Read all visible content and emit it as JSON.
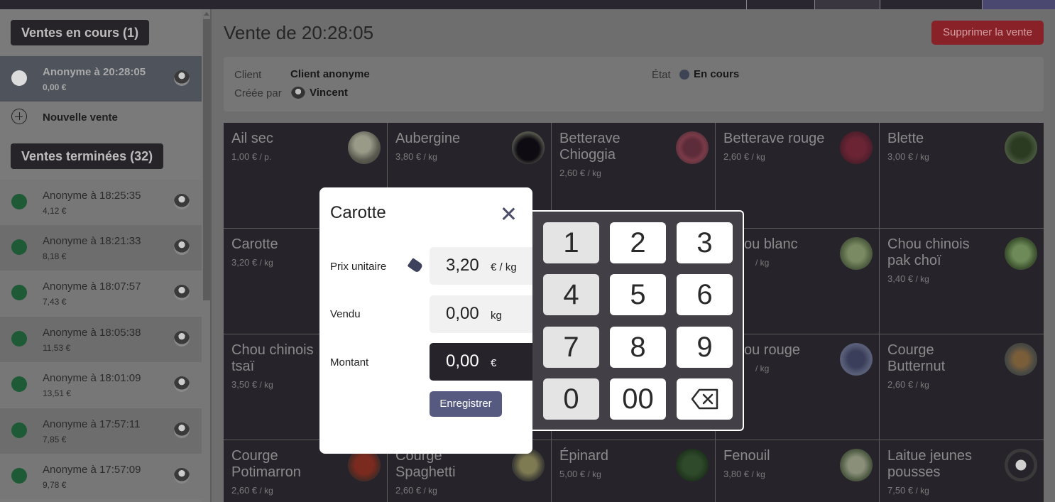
{
  "sidebar": {
    "current_header": "Ventes en cours (1)",
    "current_sale": {
      "title": "Anonyme à 20:28:05",
      "amount": "0,00 €"
    },
    "new_sale_label": "Nouvelle vente",
    "done_header": "Ventes terminées (32)",
    "done_sales": [
      {
        "title": "Anonyme à 18:25:35",
        "amount": "4,12 €"
      },
      {
        "title": "Anonyme à 18:21:33",
        "amount": "8,18 €"
      },
      {
        "title": "Anonyme à 18:07:57",
        "amount": "7,43 €"
      },
      {
        "title": "Anonyme à 18:05:38",
        "amount": "11,53 €"
      },
      {
        "title": "Anonyme à 18:01:09",
        "amount": "13,51 €"
      },
      {
        "title": "Anonyme à 17:57:11",
        "amount": "7,85 €"
      },
      {
        "title": "Anonyme à 17:57:09",
        "amount": "9,78 €"
      }
    ]
  },
  "header": {
    "title": "Vente de 20:28:05",
    "delete_label": "Supprimer la vente"
  },
  "info": {
    "client_label": "Client",
    "client_value": "Client anonyme",
    "creator_label": "Créée par",
    "creator_value": "Vincent",
    "state_label": "État",
    "state_value": "En cours"
  },
  "products": [
    {
      "name": "Ail sec",
      "price": "1,00 €",
      "unit": " / p."
    },
    {
      "name": "Aubergine",
      "price": "3,80 €",
      "unit": " / kg"
    },
    {
      "name": "Betterave Chioggia",
      "price": "2,60 €",
      "unit": " / kg"
    },
    {
      "name": "Betterave rouge",
      "price": "2,60 €",
      "unit": " / kg"
    },
    {
      "name": "Blette",
      "price": "3,00 €",
      "unit": " / kg"
    },
    {
      "name": "Carotte",
      "price": "3,20 €",
      "unit": " / kg"
    },
    {
      "name": "",
      "price": "",
      "unit": ""
    },
    {
      "name": "",
      "price": "",
      "unit": ""
    },
    {
      "name": "ou blanc",
      "price": "",
      "unit": " / kg"
    },
    {
      "name": "Chou chinois pak choï",
      "price": "3,40 €",
      "unit": " / kg"
    },
    {
      "name": "Chou chinois tsaï",
      "price": "3,50 €",
      "unit": " / kg"
    },
    {
      "name": "",
      "price": "",
      "unit": ""
    },
    {
      "name": "",
      "price": "",
      "unit": ""
    },
    {
      "name": "ou rouge",
      "price": "",
      "unit": " / kg"
    },
    {
      "name": "Courge Butternut",
      "price": "2,60 €",
      "unit": " / kg"
    },
    {
      "name": "Courge Potimarron",
      "price": "2,60 €",
      "unit": " / kg"
    },
    {
      "name": "Courge Spaghetti",
      "price": "2,60 €",
      "unit": " / kg"
    },
    {
      "name": "Épinard",
      "price": "5,00 €",
      "unit": " / kg"
    },
    {
      "name": "Fenouil",
      "price": "3,80 €",
      "unit": " / kg"
    },
    {
      "name": "Laitue jeunes pousses",
      "price": "7,50 €",
      "unit": " / kg"
    }
  ],
  "modal": {
    "title": "Carotte",
    "unit_price_label": "Prix unitaire",
    "unit_price_value": "3,20",
    "unit_price_unit": "€  / kg",
    "sold_label": "Vendu",
    "sold_value": "0,00",
    "sold_unit": "kg",
    "amount_label": "Montant",
    "amount_value": "0,00",
    "amount_unit": "€",
    "save_label": "Enregistrer"
  },
  "keypad": {
    "keys": [
      "1",
      "2",
      "3",
      "4",
      "5",
      "6",
      "7",
      "8",
      "9",
      "0",
      "00"
    ]
  },
  "icons": {
    "close": "close-icon",
    "tag": "price-tag-icon",
    "backspace": "backspace-icon",
    "add": "plus-circle-icon",
    "status_dot": "status-dot-icon"
  },
  "colors": {
    "accent": "#575a80",
    "danger": "#882228",
    "tile_bg": "#26232a",
    "status_done": "#1f5a36",
    "status_current": "#3e4454"
  }
}
